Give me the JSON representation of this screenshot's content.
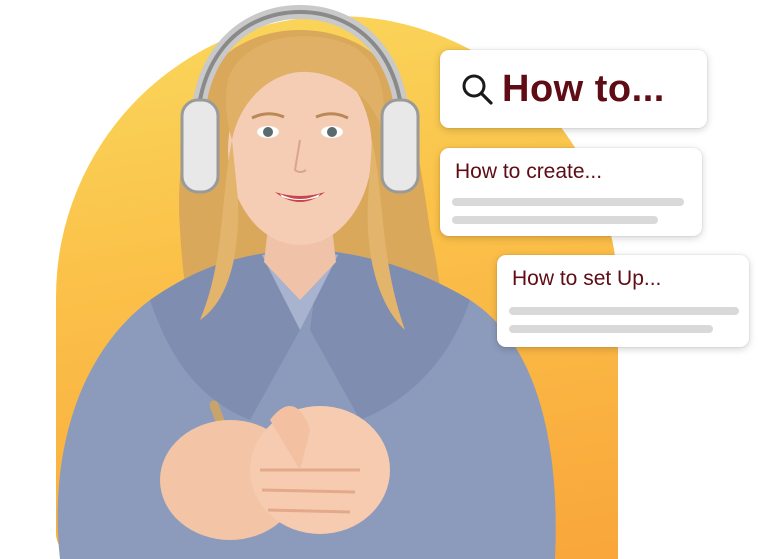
{
  "search": {
    "query": "How to...",
    "icon": "search-icon"
  },
  "results": [
    {
      "title": "How to create..."
    },
    {
      "title": "How to set Up..."
    }
  ],
  "colors": {
    "accent_text": "#5f0c14",
    "backdrop_top": "#f9d85c",
    "backdrop_bottom": "#f9a63a",
    "placeholder_line": "#d9d9d9"
  },
  "photo": {
    "subject": "smiling woman wearing headphones"
  }
}
